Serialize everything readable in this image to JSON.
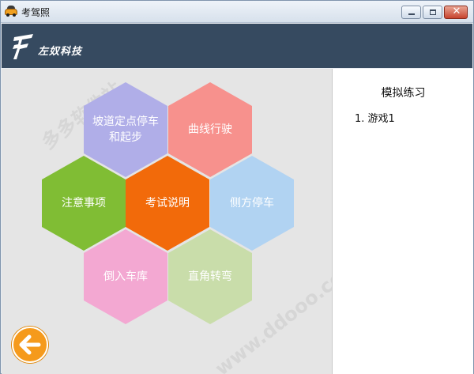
{
  "window": {
    "title": "考驾照",
    "minimize_label": "",
    "maximize_label": "",
    "close_label": "✕"
  },
  "header": {
    "logo_text": "左奴科技"
  },
  "menu": {
    "hexes": [
      {
        "id": "ramp",
        "label": "坡道定点停车\n和起步",
        "color": "#b0aee8"
      },
      {
        "id": "curve",
        "label": "曲线行驶",
        "color": "#f7918d"
      },
      {
        "id": "notes",
        "label": "注意事项",
        "color": "#80bd34"
      },
      {
        "id": "exam",
        "label": "考试说明",
        "color": "#f26a0a"
      },
      {
        "id": "side-parking",
        "label": "侧方停车",
        "color": "#b1d3f2"
      },
      {
        "id": "reverse",
        "label": "倒入车库",
        "color": "#f3a8d2"
      },
      {
        "id": "right-angle",
        "label": "直角转弯",
        "color": "#c9ddaa"
      }
    ]
  },
  "side_panel": {
    "title": "模拟练习",
    "items": [
      "1. 游戏1"
    ]
  },
  "watermark": {
    "text1": "多多软件站",
    "text2": "www.ddooo.com"
  },
  "colors": {
    "header_bg": "#364a60",
    "back_button": "#f59a1c"
  }
}
